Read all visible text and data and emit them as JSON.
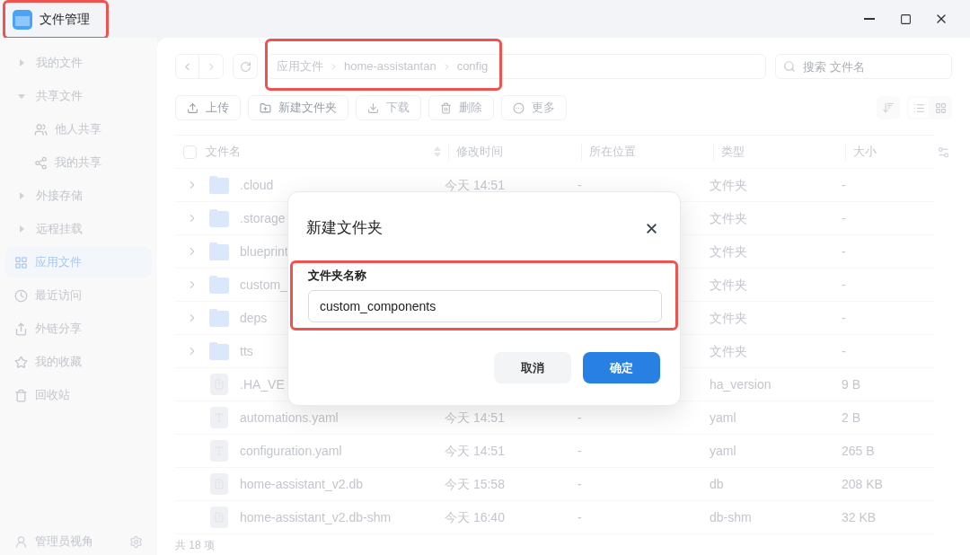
{
  "window": {
    "title": "文件管理"
  },
  "sidebar": {
    "items": [
      {
        "kind": "group",
        "label": "我的文件",
        "expanded": false,
        "selected": false
      },
      {
        "kind": "group",
        "label": "共享文件",
        "expanded": true,
        "selected": false
      },
      {
        "kind": "child",
        "label": "他人共享",
        "selected": false
      },
      {
        "kind": "child",
        "label": "我的共享",
        "selected": false
      },
      {
        "kind": "group",
        "label": "外接存储",
        "expanded": false,
        "selected": false
      },
      {
        "kind": "group",
        "label": "远程挂载",
        "expanded": false,
        "selected": false
      },
      {
        "kind": "nav",
        "label": "应用文件",
        "selected": true
      },
      {
        "kind": "nav",
        "label": "最近访问",
        "selected": false
      },
      {
        "kind": "nav",
        "label": "外链分享",
        "selected": false
      },
      {
        "kind": "nav",
        "label": "我的收藏",
        "selected": false
      },
      {
        "kind": "nav",
        "label": "回收站",
        "selected": false
      }
    ],
    "user": "管理员视角"
  },
  "breadcrumb": [
    "应用文件",
    "home-assistantan",
    "config"
  ],
  "search": {
    "placeholder": "搜索 文件名"
  },
  "toolbar": [
    {
      "label": "上传",
      "disabled": false
    },
    {
      "label": "新建文件夹",
      "disabled": false
    },
    {
      "label": "下载",
      "disabled": true
    },
    {
      "label": "删除",
      "disabled": true
    },
    {
      "label": "更多",
      "disabled": true
    }
  ],
  "table": {
    "select_all_checked": false,
    "columns": [
      "文件名",
      "修改时间",
      "所在位置",
      "类型",
      "大小"
    ],
    "rows": [
      {
        "kind": "folder",
        "name": ".cloud",
        "time": "今天 14:51",
        "location": "-",
        "type": "文件夹",
        "size": "-"
      },
      {
        "kind": "folder",
        "name": ".storage",
        "type": "文件夹",
        "size": "-"
      },
      {
        "kind": "folder",
        "name": "blueprint",
        "type": "文件夹",
        "size": "-"
      },
      {
        "kind": "folder",
        "name": "custom_",
        "type": "文件夹",
        "size": "-"
      },
      {
        "kind": "folder",
        "name": "deps",
        "type": "文件夹",
        "size": "-"
      },
      {
        "kind": "folder",
        "name": "tts",
        "type": "文件夹",
        "size": "-"
      },
      {
        "kind": "unknown",
        "name": ".HA_VE",
        "type": "ha_version",
        "size": "9 B"
      },
      {
        "kind": "text",
        "name": "automations.yaml",
        "time": "今天 14:51",
        "location": "-",
        "type": "yaml",
        "size": "2 B"
      },
      {
        "kind": "text",
        "name": "configuration.yaml",
        "time": "今天 14:51",
        "location": "-",
        "type": "yaml",
        "size": "265 B"
      },
      {
        "kind": "unknown",
        "name": "home-assistant_v2.db",
        "time": "今天 15:58",
        "location": "-",
        "type": "db",
        "size": "208 KB"
      },
      {
        "kind": "unknown",
        "name": "home-assistant_v2.db-shm",
        "time": "今天 16:40",
        "location": "-",
        "type": "db-shm",
        "size": "32 KB"
      }
    ]
  },
  "status_bar": "共 18 项",
  "dialog": {
    "title": "新建文件夹",
    "field_label": "文件夹名称",
    "value": "custom_components",
    "buttons": [
      {
        "label": "取消",
        "primary": false
      },
      {
        "label": "确定",
        "primary": true
      }
    ]
  }
}
